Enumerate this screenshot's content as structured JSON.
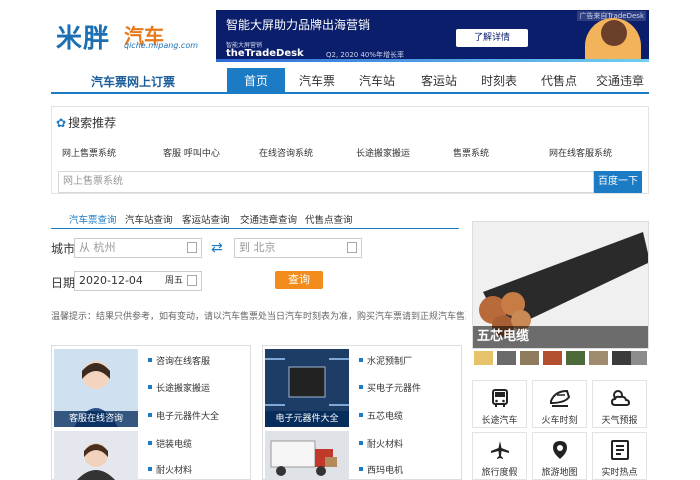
{
  "logo": {
    "main": "米胖",
    "sub": "汽车",
    "url": "qiche.mipang.com"
  },
  "banner": {
    "title": "智能大屏助力品牌出海营销",
    "button": "了解详情",
    "tag": "广告来自TradeDesk",
    "small": "智能大屏营销",
    "brand": "theTradeDesk",
    "q2": "Q2, 2020 40%年增长率"
  },
  "nav": {
    "title": "汽车票网上订票",
    "tabs": [
      "首页",
      "汽车票",
      "汽车站",
      "客运站",
      "时刻表",
      "代售点",
      "交通违章"
    ]
  },
  "recommend": {
    "title": "搜索推荐",
    "links": [
      "网上售票系统",
      "客服 呼叫中心",
      "在线咨询系统",
      "长途搬家搬运",
      "售票系统",
      "网在线客服系统"
    ],
    "input_placeholder": "网上售票系统",
    "button": "百度一下"
  },
  "query": {
    "tabs": [
      "汽车票查询",
      "汽车站查询",
      "客运站查询",
      "交通违章查询",
      "代售点查询"
    ],
    "city_label": "城市",
    "from_placeholder": "从 杭州",
    "to_placeholder": "到 北京",
    "date_label": "日期",
    "date_value": "2020-12-04",
    "weekday": "周五",
    "button": "查询",
    "tip": "温馨提示：结果只供参考，如有变动，请以汽车售票处当日汽车时刻表为准，购买汽车票请到正规汽车售票点。"
  },
  "product": {
    "label": "五芯电缆"
  },
  "services": [
    {
      "caption": "客服在线咨询",
      "links": [
        "咨询在线客服",
        "长途搬家搬运",
        "电子元器件大全",
        "铠装电缆",
        "耐火材料"
      ]
    },
    {
      "caption": "电子元器件大全",
      "links": [
        "水泥预制厂",
        "买电子元器件",
        "五芯电缆",
        "耐火材料",
        "西玛电机"
      ]
    }
  ],
  "grid": [
    {
      "label": "长途汽车",
      "icon": "bus-icon"
    },
    {
      "label": "火车时刻",
      "icon": "train-icon"
    },
    {
      "label": "天气预报",
      "icon": "weather-icon"
    },
    {
      "label": "旅行度假",
      "icon": "plane-icon"
    },
    {
      "label": "旅游地图",
      "icon": "map-pin-icon"
    },
    {
      "label": "实时热点",
      "icon": "hot-news-icon"
    }
  ],
  "colors": {
    "accent": "#1b7bc4",
    "orange": "#f28c1a",
    "logo_blue": "#1c6fb3"
  }
}
